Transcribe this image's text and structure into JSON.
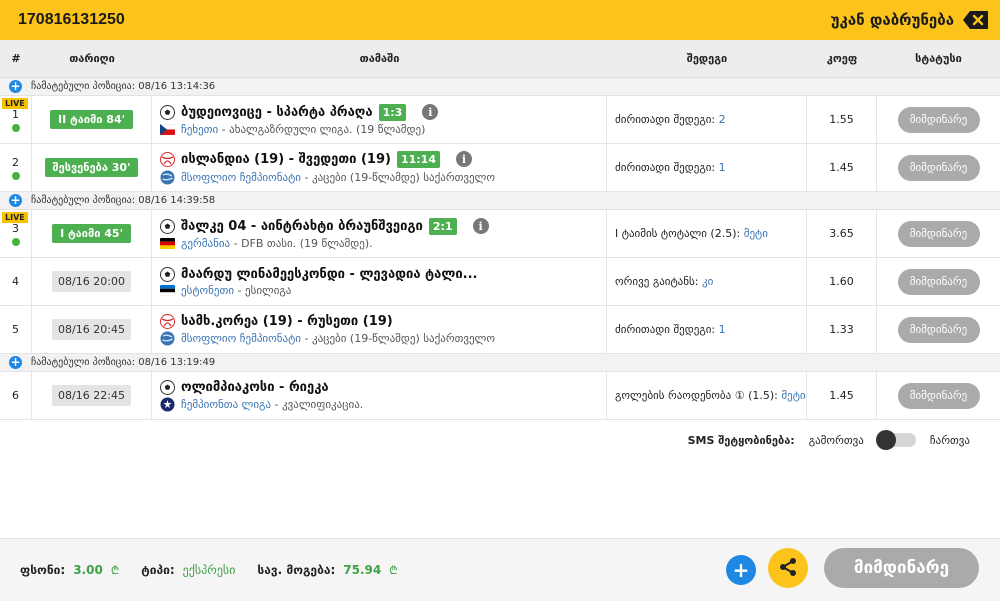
{
  "header": {
    "ticket_id": "170816131250",
    "back_label": "უკან დაბრუნება"
  },
  "columns": {
    "num": "#",
    "date": "თარიღი",
    "match": "თამაში",
    "outcome": "შედეგი",
    "odds": "კოეფ",
    "status": "სტატუსი"
  },
  "groups": [
    {
      "label": "ჩამატებული პოზიცია: 08/16 13:14:36",
      "events": [
        {
          "num": "1",
          "live": true,
          "live_label": "LIVE",
          "time": "II ტაიმი 84'",
          "time_type": "live",
          "match": "ბუდეიოვიცე - სპარტა პრაღა",
          "score": "1:3",
          "country": "ჩეხეთი",
          "league": "ახალგაზრდული ლიგა. (19 წლამდე)",
          "flag": "czech",
          "ball": "ball",
          "outcome_label": "ძირითადი შედეგი:",
          "outcome_pick": "2",
          "odds": "1.55",
          "status": "მიმდინარე"
        },
        {
          "num": "2",
          "live": false,
          "time": "შესვენება 30'",
          "time_type": "live",
          "match": "ისლანდია (19) - შვედეთი (19)",
          "score": "11:14",
          "country": "მსოფლიო ჩემპიონატი",
          "league": "კაცები (19-წლამდე) საქართველო",
          "flag": "world",
          "ball": "handball",
          "outcome_label": "ძირითადი შედეგი:",
          "outcome_pick": "1",
          "odds": "1.45",
          "status": "მიმდინარე"
        }
      ]
    },
    {
      "label": "ჩამატებული პოზიცია: 08/16 14:39:58",
      "events": [
        {
          "num": "3",
          "live": true,
          "live_label": "LIVE",
          "time": "I ტაიმი 45'",
          "time_type": "live",
          "match": "შალკე 04 - აინტრახტი ბრაუნშვეიგი",
          "score": "2:1",
          "country": "გერმანია",
          "league": "DFB თასი. (19 წლამდე).",
          "flag": "germany",
          "ball": "ball",
          "outcome_label": "I ტაიმის ტოტალი (2.5):",
          "outcome_pick": "მეტი",
          "odds": "3.65",
          "status": "მიმდინარე"
        },
        {
          "num": "4",
          "live": false,
          "time": "08/16 20:00",
          "time_type": "scheduled",
          "match": "მაარდუ ლინამეესკონდი - ლევადია ტალი...",
          "score": "",
          "country": "ესტონეთი",
          "league": "ესილიგა",
          "flag": "estonia",
          "ball": "ball",
          "outcome_label": "ორივე გაიტანს:",
          "outcome_pick": "კი",
          "odds": "1.60",
          "status": "მიმდინარე"
        },
        {
          "num": "5",
          "live": false,
          "time": "08/16 20:45",
          "time_type": "scheduled",
          "match": "სამხ.კორეა (19) - რუსეთი (19)",
          "score": "",
          "country": "მსოფლიო ჩემპიონატი",
          "league": "კაცები (19-წლამდე) საქართველო",
          "flag": "world",
          "ball": "handball",
          "outcome_label": "ძირითადი შედეგი:",
          "outcome_pick": "1",
          "odds": "1.33",
          "status": "მიმდინარე"
        }
      ]
    },
    {
      "label": "ჩამატებული პოზიცია: 08/16 13:19:49",
      "events": [
        {
          "num": "6",
          "live": false,
          "time": "08/16 22:45",
          "time_type": "scheduled",
          "match": "ოლიმპიაკოსი - რიეკა",
          "score": "",
          "country": "ჩემპიონთა ლიგა",
          "league": "კვალიფიკაცია.",
          "flag": "ucl",
          "ball": "ball",
          "outcome_label": "გოლების რაოდენობა ① (1.5):",
          "outcome_pick": "მეტი",
          "odds": "1.45",
          "status": "მიმდინარე"
        }
      ]
    }
  ],
  "sms": {
    "label": "SMS შეტყობინება:",
    "off": "გამორთვა",
    "on": "ჩართვა"
  },
  "footer": {
    "stake_label": "ფსონი:",
    "stake_value": "3.00",
    "currency": "₾",
    "type_label": "ტიპი:",
    "type_value": "ექსპრესი",
    "win_label": "სავ. მოგება:",
    "win_value": "75.94",
    "status_button": "მიმდინარე"
  },
  "colors": {
    "accent": "#fcc41a",
    "live_green": "#4caf50",
    "link_blue": "#3b74b4",
    "status_grey": "#aaaaaa",
    "plus_blue": "#1e88e5"
  }
}
